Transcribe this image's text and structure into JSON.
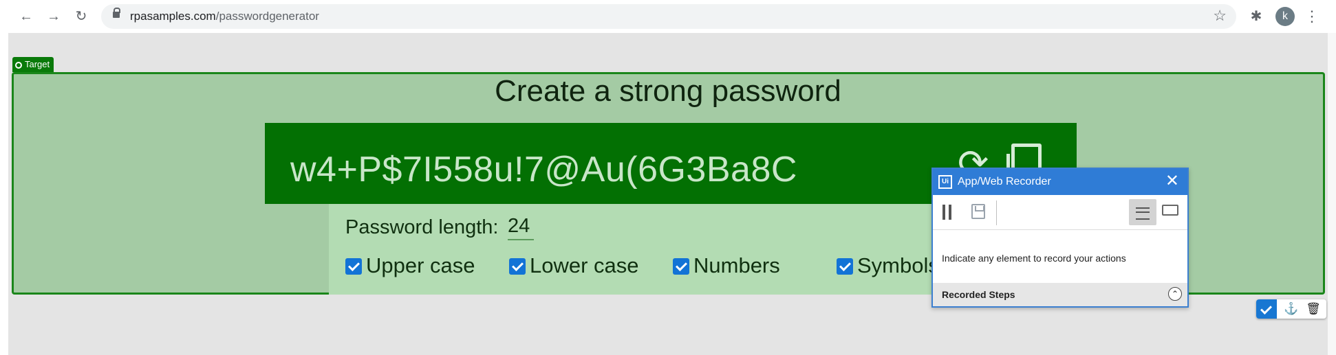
{
  "browser": {
    "url_domain": "rpasamples.com",
    "url_path": "/passwordgenerator",
    "avatar_letter": "k",
    "icons": [
      "back-icon",
      "forward-icon",
      "reload-icon",
      "lock-icon",
      "star-icon",
      "extensions-icon",
      "menu-icon"
    ]
  },
  "target_tag": "Target",
  "page": {
    "title": "Create a strong password",
    "password": "w4+P$7I558u!7@Au(6G3Ba8C",
    "length_label": "Password length:",
    "length_value": "24",
    "options": [
      {
        "label": "Upper case",
        "checked": true
      },
      {
        "label": "Lower case",
        "checked": true
      },
      {
        "label": "Numbers",
        "checked": true
      },
      {
        "label": "Symbols",
        "checked": true
      }
    ]
  },
  "recorder": {
    "title": "App/Web Recorder",
    "message": "Indicate any element to record your actions",
    "recorded_steps_label": "Recorded Steps",
    "header_color": "#2f7cd6"
  },
  "colors": {
    "target_border": "#1a861a",
    "password_bar": "#037003",
    "checkbox": "#1273d6"
  }
}
